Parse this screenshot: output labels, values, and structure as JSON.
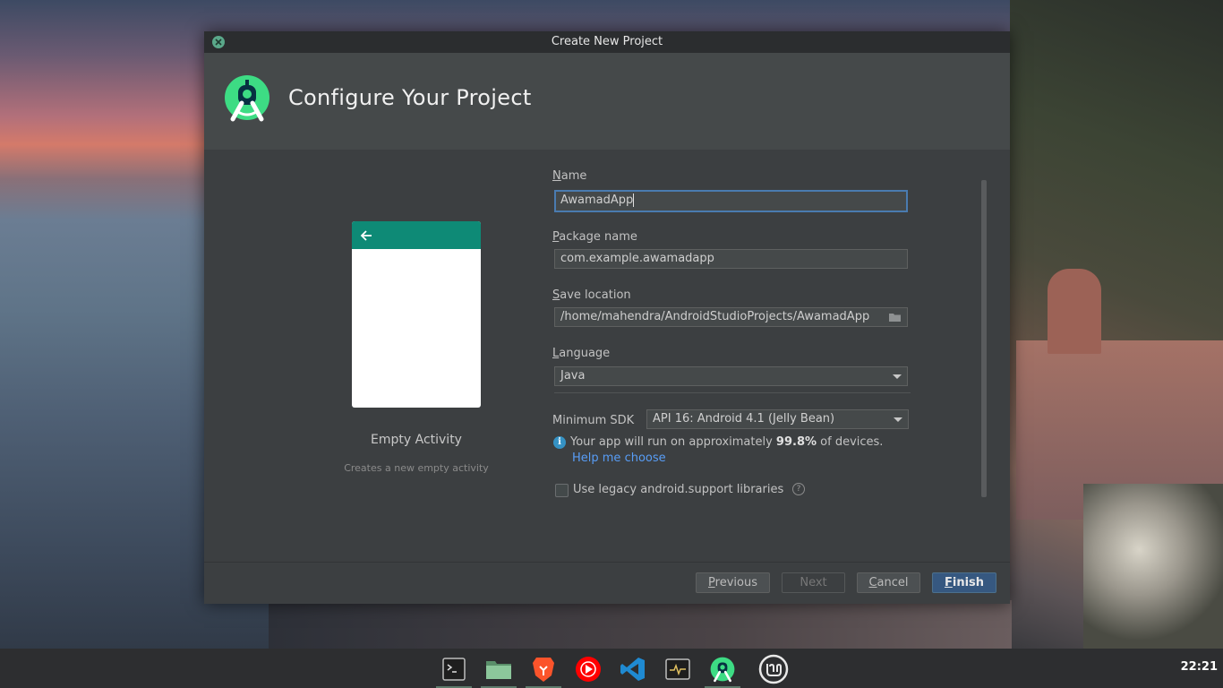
{
  "window": {
    "title": "Create New Project"
  },
  "header": {
    "title": "Configure Your Project"
  },
  "template": {
    "name": "Empty Activity",
    "description": "Creates a new empty activity"
  },
  "form": {
    "name": {
      "label_underline": "N",
      "label_rest": "ame",
      "value": "AwamadApp"
    },
    "package": {
      "label_underline": "P",
      "label_rest": "ackage name",
      "value": "com.example.awamadapp"
    },
    "save_location": {
      "label_underline": "S",
      "label_rest": "ave location",
      "value": "/home/mahendra/AndroidStudioProjects/AwamadApp"
    },
    "language": {
      "label_underline": "L",
      "label_rest": "anguage",
      "value": "Java"
    },
    "min_sdk": {
      "label": "Minimum SDK",
      "value": "API 16: Android 4.1 (Jelly Bean)"
    },
    "info": {
      "prefix": "Your app will run on approximately ",
      "percent": "99.8%",
      "suffix": " of devices.",
      "link": "Help me choose"
    },
    "legacy": {
      "label": "Use legacy android.support libraries",
      "checked": false
    }
  },
  "buttons": {
    "previous": {
      "u": "P",
      "rest": "revious"
    },
    "next": "Next",
    "cancel": {
      "u": "C",
      "rest": "ancel"
    },
    "finish": {
      "u": "F",
      "rest": "inish"
    }
  },
  "taskbar": {
    "apps": [
      "terminal-icon",
      "files-icon",
      "brave-icon",
      "youtube-music-icon",
      "vscode-icon",
      "system-monitor-icon",
      "android-studio-icon",
      "mint-menu-icon"
    ],
    "clock": "22:21"
  },
  "colors": {
    "accent": "#365880",
    "teal": "#0e8a76",
    "link": "#589df6"
  }
}
